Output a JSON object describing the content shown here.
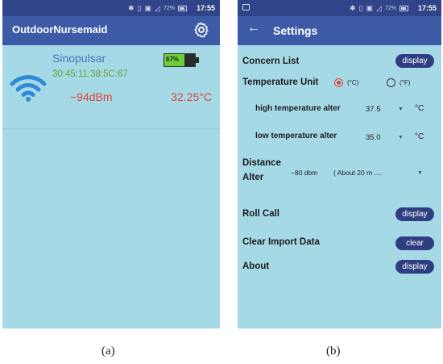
{
  "status_bar": {
    "battery_pct": "72%",
    "time": "17:55"
  },
  "panel_a": {
    "app_title": "OutdoorNursemaid",
    "device": {
      "name": "Sinopulsar",
      "mac": "30:45:11:38:5C:67",
      "rssi": "−94dBm",
      "temperature": "32.25°C",
      "battery": "67%",
      "battery_level": 0.67
    },
    "caption": "(a)"
  },
  "panel_b": {
    "back_glyph": "←",
    "title": "Settings",
    "concern_list": {
      "label": "Concern List",
      "button": "display"
    },
    "temperature_unit": {
      "label": "Temperature Unit",
      "celsius": "(°C)",
      "fahrenheit": "(°F)",
      "selected": "celsius"
    },
    "high_alter": {
      "label": "high temperature alter",
      "value": "37.5",
      "unit": "°C"
    },
    "low_alter": {
      "label": "low temperature alter",
      "value": "35.0",
      "unit": "°C"
    },
    "distance_alter": {
      "label_line1": "Distance",
      "label_line2": "Alter",
      "value": "−80 dbm",
      "option": "( About 20 m ...."
    },
    "roll_call": {
      "label": "Roll Call",
      "button": "display"
    },
    "clear_import": {
      "label": "Clear Import Data",
      "button": "clear"
    },
    "about": {
      "label": "About",
      "button": "display"
    },
    "caption": "(b)"
  },
  "icons": {
    "status": [
      "bluetooth-icon",
      "vibrate-icon",
      "sim-icon",
      "no-signal-icon",
      "battery-icon"
    ],
    "panel_a": [
      "gear-icon",
      "wifi-signal-icon",
      "battery-level-icon"
    ],
    "panel_b": [
      "back-arrow-icon",
      "dropdown-caret-icon"
    ]
  }
}
